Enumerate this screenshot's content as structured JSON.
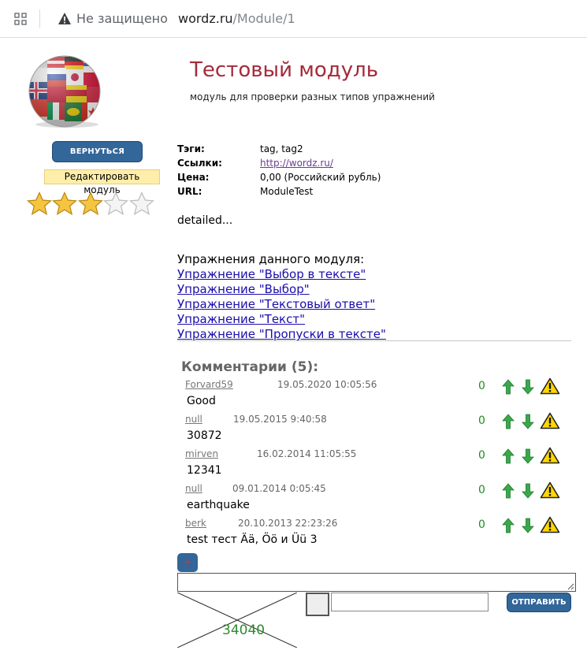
{
  "browser": {
    "security_label": "Не защищено",
    "url_host": "wordz.ru",
    "url_path": "/Module/1"
  },
  "sidebar": {
    "back_button": "ВЕРНУТЬСЯ НАЗАД",
    "edit_module": "Редактировать модуль",
    "rating": {
      "value": 3,
      "max": 5
    }
  },
  "module": {
    "title": "Тестовый модуль",
    "subtitle": "модуль для проверки разных типов упражнений",
    "info": [
      {
        "key": "Тэги:",
        "value": "tag, tag2",
        "link": false
      },
      {
        "key": "Ссылки:",
        "value": "http://wordz.ru/",
        "link": true
      },
      {
        "key": "Цена:",
        "value": "0,00 (Российский рубль)",
        "link": false
      },
      {
        "key": "URL:",
        "value": "ModuleTest",
        "link": false
      }
    ],
    "detailed": "detailed...",
    "exercises_heading": "Упражнения данного модуля:",
    "exercises": [
      "Упражнение \"Выбор в тексте\"",
      "Упражнение \"Выбор\"",
      "Упражнение \"Текстовый ответ\"",
      "Упражнение \"Текст\"",
      "Упражнение \"Пропуски в тексте\""
    ]
  },
  "comments": {
    "title": "Комментарии (5):",
    "items": [
      {
        "author": "Forvard59",
        "date": "19.05.2020 10:05:56",
        "text": "Good",
        "score": "0"
      },
      {
        "author": "null",
        "date": "19.05.2015 9:40:58",
        "text": "30872",
        "score": "0"
      },
      {
        "author": "mirven",
        "date": "16.02.2014 11:05:55",
        "text": "12341",
        "score": "0"
      },
      {
        "author": "null",
        "date": "09.01.2014 0:05:45",
        "text": "earthquake",
        "score": "0"
      },
      {
        "author": "berk",
        "date": "20.10.2013 22:23:26",
        "text": "test тест Ää, Öö и Üü 3",
        "score": "0"
      }
    ],
    "add_label": "+",
    "captcha_code": "34040",
    "send_button": "ОТПРАВИТЬ"
  },
  "colors": {
    "title": "#a52a3a",
    "button_bg": "#336699",
    "link": "#1a0dab",
    "score": "#228b22"
  }
}
